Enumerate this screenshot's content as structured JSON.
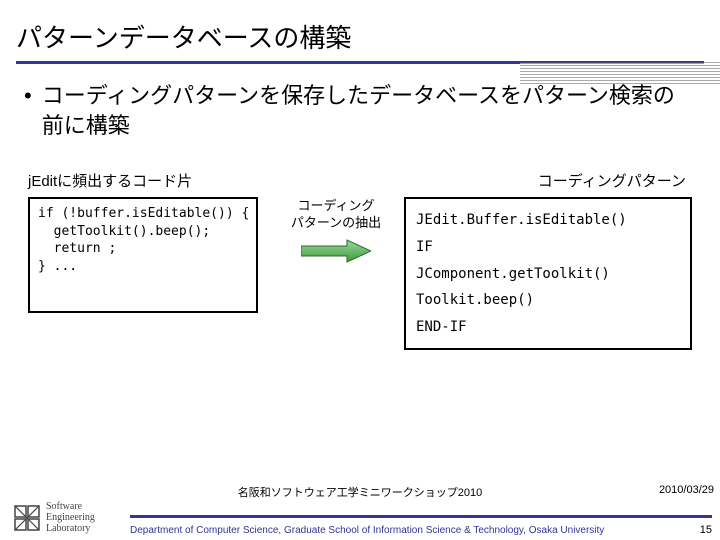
{
  "title": "パターンデータベースの構築",
  "bullet": "コーディングパターンを保存したデータベースをパターン検索の前に構築",
  "left_label": "jEditに頻出するコード片",
  "code": "if (!buffer.isEditable()) {\n  getToolkit().beep();\n  return ;\n} ...",
  "mid_label_l1": "コーディング",
  "mid_label_l2": "パターンの抽出",
  "right_label": "コーディングパターン",
  "pattern_lines": {
    "l1": "JEdit.Buffer.isEditable()",
    "l2": "IF",
    "l3": "JComponent.getToolkit()",
    "l4": "Toolkit.beep()",
    "l5": "END-IF"
  },
  "footer": {
    "center": "名阪和ソフトウェア工学ミニワークショップ2010",
    "date": "2010/03/29",
    "dept": "Department of Computer Science, Graduate School of Information Science & Technology, Osaka University",
    "page": "15",
    "logo_l1": "Software",
    "logo_l2": "Engineering",
    "logo_l3": "Laboratory"
  }
}
